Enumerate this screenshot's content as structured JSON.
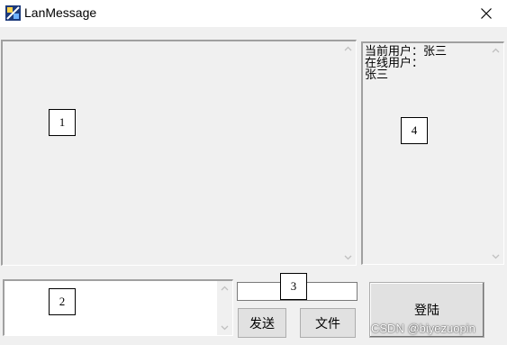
{
  "window": {
    "title": "LanMessage"
  },
  "user_panel": {
    "current_user_line": "当前用户：张三",
    "online_label": "在线用户：",
    "online_users": [
      "张三"
    ]
  },
  "markers": {
    "m1": "1",
    "m2": "2",
    "m3": "3",
    "m4": "4"
  },
  "buttons": {
    "send": "发送",
    "file": "文件",
    "login": "登陆"
  },
  "inputs": {
    "message_value": "",
    "file_path_value": ""
  },
  "watermark": "CSDN @biyezuopin"
}
